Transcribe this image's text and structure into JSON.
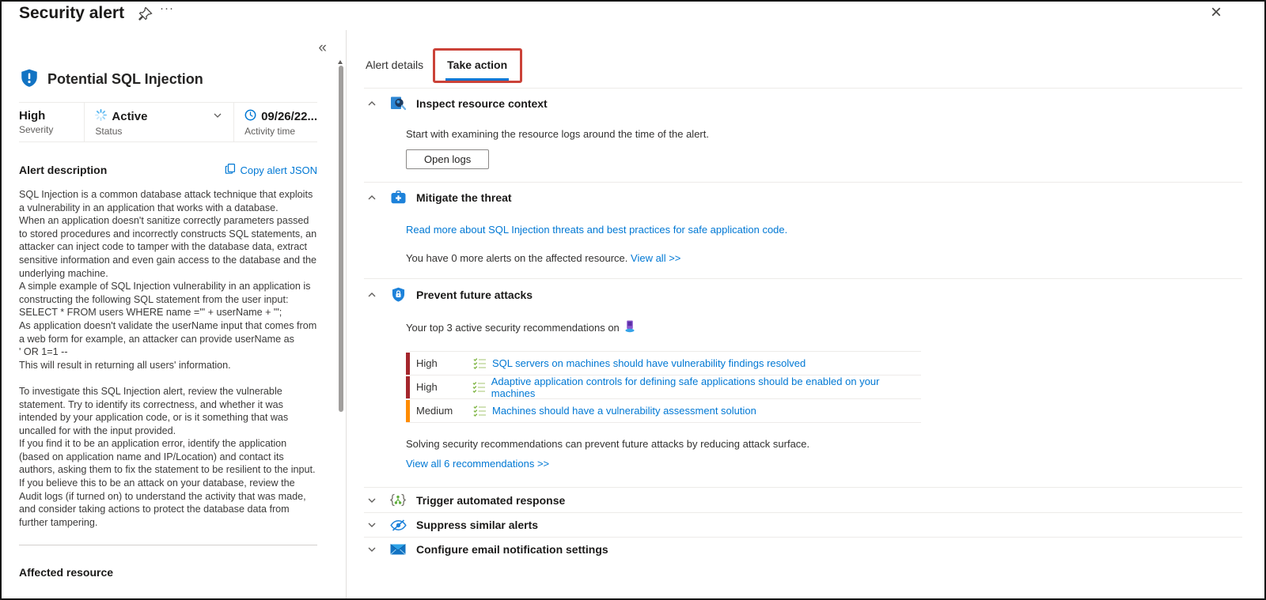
{
  "window": {
    "title": "Security alert"
  },
  "icons": {
    "more": "···",
    "close": "×",
    "collapse": "«"
  },
  "colors": {
    "accent_blue": "#0078d4",
    "severity_high": "#a4262c",
    "severity_medium": "#ff8c00",
    "annotation_red": "#cb4238"
  },
  "alert": {
    "name": "Potential SQL Injection",
    "severity": {
      "value": "High",
      "label": "Severity"
    },
    "status": {
      "value": "Active",
      "label": "Status"
    },
    "activity_time": {
      "value": "09/26/22...",
      "label": "Activity time"
    },
    "description_heading": "Alert description",
    "copy_json_label": "Copy alert JSON",
    "description": "SQL Injection is a common database attack technique that exploits a vulnerability in an application that works with a database.\nWhen an application doesn't sanitize correctly parameters passed to stored procedures and incorrectly constructs SQL statements, an attacker can inject code to tamper with the database data, extract sensitive information and even gain access to the database and the underlying machine.\nA simple example of SQL Injection vulnerability in an application is constructing the following SQL statement from the user input:\nSELECT * FROM users WHERE name ='\" + userName + \"';\nAs application doesn't validate the userName input that comes from a web form for example, an attacker can provide userName as\n' OR 1=1 --\nThis will result in returning all users' information.\n\nTo investigate this SQL Injection alert, review the vulnerable statement. Try to identify its correctness, and whether it was intended by your application code, or is it something that was uncalled for with the input provided.\nIf you find it to be an application error, identify the application (based on application name and IP/Location) and contact its authors, asking them to fix the statement to be resilient to the input.\nIf you believe this to be an attack on your database, review the Audit logs (if turned on) to understand the activity that was made, and consider taking actions to protect the database data from further tampering.",
    "affected_resource_heading": "Affected resource"
  },
  "tabs": [
    {
      "label": "Alert details"
    },
    {
      "label": "Take action"
    }
  ],
  "sections": {
    "inspect": {
      "title": "Inspect resource context",
      "body": "Start with examining the resource logs around the time of the alert.",
      "button": "Open logs"
    },
    "mitigate": {
      "title": "Mitigate the threat",
      "link": "Read more about SQL Injection threats and best practices for safe application code.",
      "more_alerts_text": "You have 0 more alerts on the affected resource. ",
      "view_all_link": "View all >>"
    },
    "prevent": {
      "title": "Prevent future attacks",
      "intro": "Your top 3 active security recommendations on",
      "recommendations": [
        {
          "severity": "High",
          "text": "SQL servers on machines should have vulnerability findings resolved"
        },
        {
          "severity": "High",
          "text": "Adaptive application controls for defining safe applications should be enabled on your machines"
        },
        {
          "severity": "Medium",
          "text": "Machines should have a vulnerability assessment solution"
        }
      ],
      "footer": "Solving security recommendations can prevent future attacks by reducing attack surface.",
      "view_all_link": "View all 6 recommendations >>"
    },
    "trigger": {
      "title": "Trigger automated response"
    },
    "suppress": {
      "title": "Suppress similar alerts"
    },
    "email": {
      "title": "Configure email notification settings"
    }
  }
}
